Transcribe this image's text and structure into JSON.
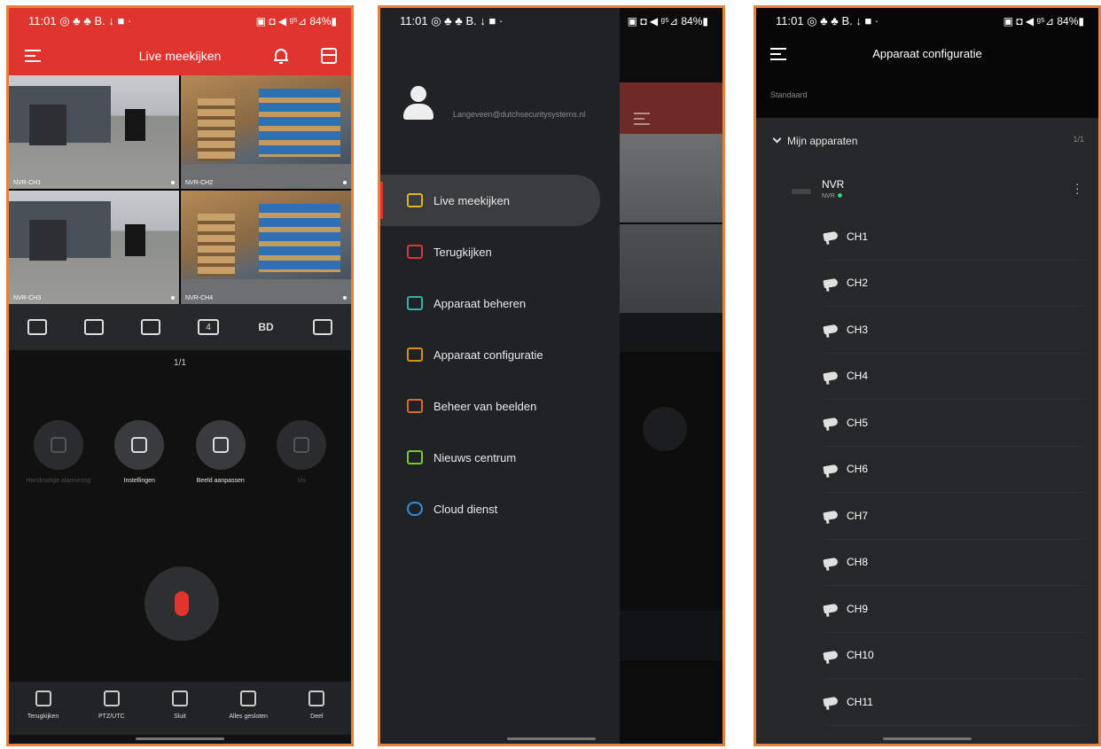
{
  "status": {
    "time": "11:01",
    "icons_left": "◎ ♣ ♣ B. ↓ ■ ·",
    "icons_right": "▣ ◘ ◀ ᵍ⁵⊿ 84%▮"
  },
  "screen1": {
    "title": "Live meekijken",
    "cameras": [
      {
        "label": "NVR-CH1",
        "scene": "outdoor"
      },
      {
        "label": "NVR-CH2",
        "scene": "indoor"
      },
      {
        "label": "NVR-CH3",
        "scene": "outdoor"
      },
      {
        "label": "NVR-CH4",
        "scene": "indoor"
      }
    ],
    "toolbar": {
      "split": "4",
      "quality": "BD"
    },
    "page_indicator": "1/1",
    "actions": [
      {
        "label": "Handmatige alarmering",
        "enabled": false,
        "icon": "alarm-icon"
      },
      {
        "label": "Instellingen",
        "enabled": true,
        "icon": "settings-icon"
      },
      {
        "label": "Beeld aanpassen",
        "enabled": true,
        "icon": "image-adjust-icon"
      },
      {
        "label": "Vis",
        "enabled": false,
        "icon": "fisheye-icon"
      }
    ],
    "bottom_tabs": [
      {
        "label": "Terugkijken",
        "icon": "playback-icon"
      },
      {
        "label": "PTZ/UTC",
        "icon": "ptz-icon"
      },
      {
        "label": "Sluit",
        "icon": "close-icon"
      },
      {
        "label": "Alles gesloten",
        "icon": "close-all-icon"
      },
      {
        "label": "Deel",
        "icon": "share-icon"
      }
    ]
  },
  "screen2": {
    "email": "Langeveen@dutchsecuritysystems.nl",
    "menu": [
      {
        "label": "Live meekijken",
        "color": "#e2b51c",
        "active": true
      },
      {
        "label": "Terugkijken",
        "color": "#e0342f",
        "active": false
      },
      {
        "label": "Apparaat beheren",
        "color": "#2fb6a8",
        "active": false
      },
      {
        "label": "Apparaat configuratie",
        "color": "#e08a1c",
        "active": false
      },
      {
        "label": "Beheer van beelden",
        "color": "#e0662f",
        "active": false
      },
      {
        "label": "Nieuws centrum",
        "color": "#7cc62f",
        "active": false
      },
      {
        "label": "Cloud dienst",
        "color": "#2f8ee0",
        "active": false
      }
    ]
  },
  "screen3": {
    "title": "Apparaat configuratie",
    "section": "Standaard",
    "group": {
      "label": "Mijn apparaten",
      "count": "1/1"
    },
    "device": {
      "name": "NVR",
      "type": "NVR",
      "status_color": "#3bd26a"
    },
    "channels": [
      "CH1",
      "CH2",
      "CH3",
      "CH4",
      "CH5",
      "CH6",
      "CH7",
      "CH8",
      "CH9",
      "CH10",
      "CH11"
    ]
  }
}
